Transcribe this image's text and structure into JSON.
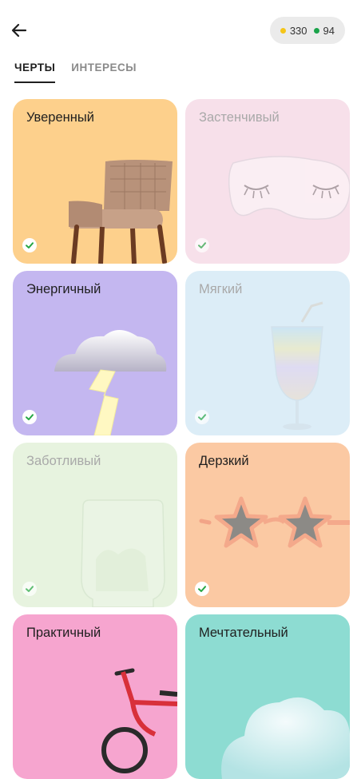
{
  "header": {
    "back_label": "Назад",
    "currency": [
      {
        "value": "330",
        "color": "#f5c518",
        "icon": "gold-coin-icon"
      },
      {
        "value": "94",
        "color": "#1aa34a",
        "icon": "green-gem-icon"
      }
    ]
  },
  "tabs": [
    {
      "label": "ЧЕРТЫ",
      "active": true
    },
    {
      "label": "ИНТЕРЕСЫ",
      "active": false
    }
  ],
  "cards": [
    {
      "label": "Уверенный",
      "bg": "#fdd08c",
      "selected": true,
      "muted": false,
      "icon": "armchair-icon"
    },
    {
      "label": "Застенчивый",
      "bg": "#f7e0ea",
      "selected": true,
      "muted": true,
      "icon": "sleep-mask-icon"
    },
    {
      "label": "Энергичный",
      "bg": "#c4b7f0",
      "selected": true,
      "muted": false,
      "icon": "thundercloud-icon"
    },
    {
      "label": "Мягкий",
      "bg": "#dcedf7",
      "selected": true,
      "muted": true,
      "icon": "cocktail-glass-icon"
    },
    {
      "label": "Заботливый",
      "bg": "#e7f3df",
      "selected": true,
      "muted": true,
      "icon": "glass-jar-icon"
    },
    {
      "label": "Дерзкий",
      "bg": "#fbc9a3",
      "selected": true,
      "muted": false,
      "icon": "star-glasses-icon"
    },
    {
      "label": "Практичный",
      "bg": "#f6a5cf",
      "selected": false,
      "muted": false,
      "icon": "bicycle-icon"
    },
    {
      "label": "Мечтательный",
      "bg": "#8ddcd2",
      "selected": false,
      "muted": false,
      "icon": "cloud-icon"
    }
  ],
  "colors": {
    "check": "#27a745",
    "text": "#1f1f1f",
    "muted_text": "#a9a9a9"
  }
}
